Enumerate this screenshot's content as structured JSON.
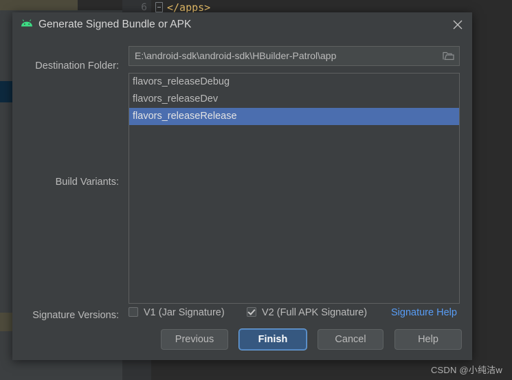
{
  "ide": {
    "line_number": "6",
    "code_text": "</apps>",
    "watermark": "CSDN @小纯洁w"
  },
  "dialog": {
    "title": "Generate Signed Bundle or APK",
    "app_icon": "android-icon",
    "close_icon": "close-icon",
    "destination": {
      "label": "Destination Folder:",
      "value": "E:\\android-sdk\\android-sdk\\HBuilder-Patrol\\app",
      "browse_icon": "folder-icon"
    },
    "build_variants": {
      "label": "Build Variants:",
      "items": [
        {
          "name": "flavors_releaseDebug",
          "selected": false
        },
        {
          "name": "flavors_releaseDev",
          "selected": false
        },
        {
          "name": "flavors_releaseRelease",
          "selected": true
        }
      ]
    },
    "signature_versions": {
      "label": "Signature Versions:",
      "v1_label": "V1 (Jar Signature)",
      "v1_checked": false,
      "v2_label": "V2 (Full APK Signature)",
      "v2_checked": true,
      "help_link": "Signature Help",
      "help_link_color": "#589df6"
    },
    "buttons": {
      "previous": "Previous",
      "finish": "Finish",
      "cancel": "Cancel",
      "help": "Help"
    },
    "colors": {
      "dialog_bg": "#3c3f41",
      "selection_blue": "#4b6eaf",
      "default_button_blue": "#365880",
      "android_green": "#3ddc84"
    }
  }
}
